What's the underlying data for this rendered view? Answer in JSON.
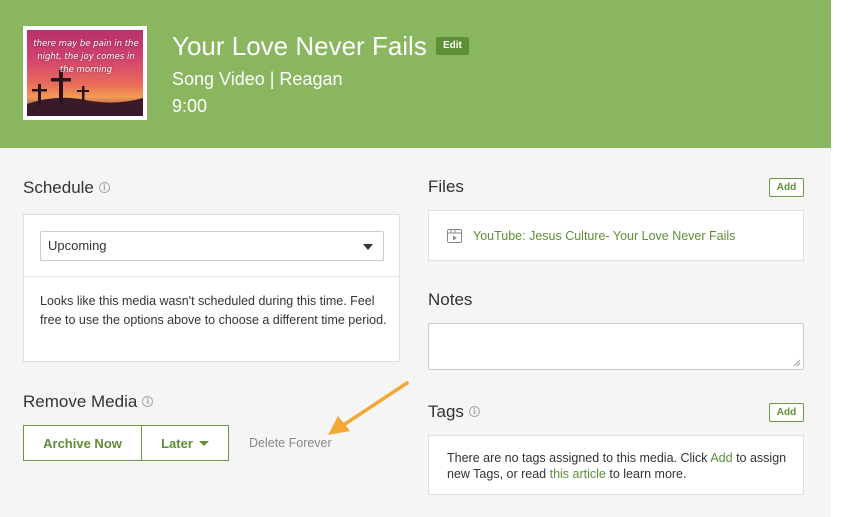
{
  "header": {
    "title": "Your Love Never Fails",
    "edit_label": "Edit",
    "subtitle": "Song Video | Reagan",
    "duration": "9:00",
    "thumbnail_caption": "there may be pain in the night, the joy comes in the morning"
  },
  "schedule": {
    "heading": "Schedule",
    "select_value": "Upcoming",
    "message": "Looks like this media wasn't scheduled during this time. Feel free to use the options above to choose a different time period."
  },
  "remove_media": {
    "heading": "Remove Media",
    "archive_label": "Archive Now",
    "later_label": "Later",
    "delete_label": "Delete Forever"
  },
  "files": {
    "heading": "Files",
    "add_label": "Add",
    "items": [
      {
        "label": "YouTube: Jesus Culture- Your Love Never Fails",
        "icon": "film-icon"
      }
    ]
  },
  "notes": {
    "heading": "Notes",
    "value": ""
  },
  "tags": {
    "heading": "Tags",
    "add_label": "Add",
    "msg_part1": "There are no tags assigned to this media. Click ",
    "msg_link_add": "Add",
    "msg_part2": " to assign new Tags, or read ",
    "msg_link_article": "this article",
    "msg_part3": " to learn more."
  },
  "colors": {
    "header_bg": "#8ab65f",
    "accent_green": "#5e8e37",
    "annotation_arrow": "#f5a733"
  }
}
